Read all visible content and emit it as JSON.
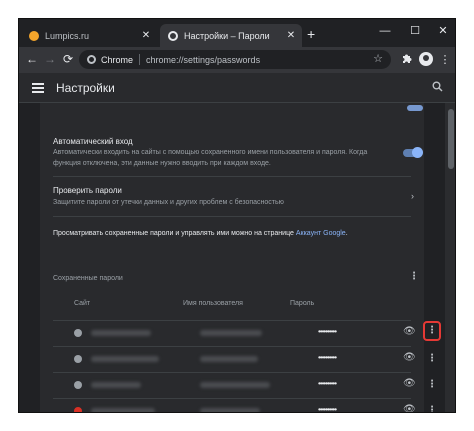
{
  "tabs": [
    {
      "label": "Lumpics.ru",
      "close": "✕"
    },
    {
      "label": "Настройки – Пароли",
      "close": "✕"
    }
  ],
  "new_tab": "+",
  "window_controls": {
    "minimize": "—",
    "maximize": "☐",
    "close": "✕"
  },
  "toolbar": {
    "back": "←",
    "forward": "→",
    "reload": "⟳",
    "omnibox_brand": "Chrome",
    "url": "chrome://settings/passwords",
    "star": "☆"
  },
  "header": {
    "title": "Настройки",
    "search_icon": "⚲"
  },
  "autologin": {
    "title": "Автоматический вход",
    "description": "Автоматически входить на сайты с помощью сохраненного имени пользователя и пароля. Когда функция отключена, эти данные нужно вводить при каждом входе.",
    "enabled": true
  },
  "check_passwords": {
    "title": "Проверить пароли",
    "description": "Защитите пароли от утечки данных и других проблем с безопасностью"
  },
  "manage": {
    "text": "Просматривать сохраненные пароли и управлять ими можно на странице ",
    "link": "Аккаунт Google",
    "end": "."
  },
  "saved": {
    "title": "Сохраненные пароли",
    "columns": {
      "site": "Сайт",
      "user": "Имя пользователя",
      "password": "Пароль"
    },
    "rows": [
      {
        "icon": "globe-icon",
        "password": "••••••••••"
      },
      {
        "icon": "globe-icon",
        "password": "••••••••••"
      },
      {
        "icon": "globe-icon",
        "password": "••••••••••"
      },
      {
        "icon": "map-pin-icon",
        "password": "••••••••••"
      }
    ]
  },
  "menu_icon": "⋮",
  "eye_icon": "👁",
  "colors": {
    "accent": "#8ab4f8",
    "highlight": "#e53935",
    "background": "#202124"
  }
}
